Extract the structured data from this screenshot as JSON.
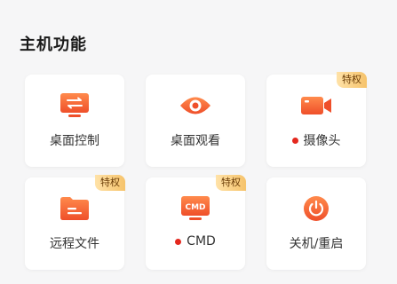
{
  "section": {
    "title": "主机功能"
  },
  "colors": {
    "accent": "#f05a32",
    "status_dot": "#e4281e",
    "badge_bg": "#f6c36b"
  },
  "cards": [
    {
      "label": "桌面控制",
      "icon": "desktop-control-icon",
      "badge": "",
      "dot": false
    },
    {
      "label": "桌面观看",
      "icon": "eye-icon",
      "badge": "",
      "dot": false
    },
    {
      "label": "摄像头",
      "icon": "video-camera-icon",
      "badge": "特权",
      "dot": true
    },
    {
      "label": "远程文件",
      "icon": "folder-icon",
      "badge": "特权",
      "dot": false
    },
    {
      "label": "CMD",
      "icon": "cmd-monitor-icon",
      "badge": "特权",
      "dot": true,
      "icon_text": "CMD"
    },
    {
      "label": "关机/重启",
      "icon": "power-icon",
      "badge": "",
      "dot": false
    }
  ]
}
